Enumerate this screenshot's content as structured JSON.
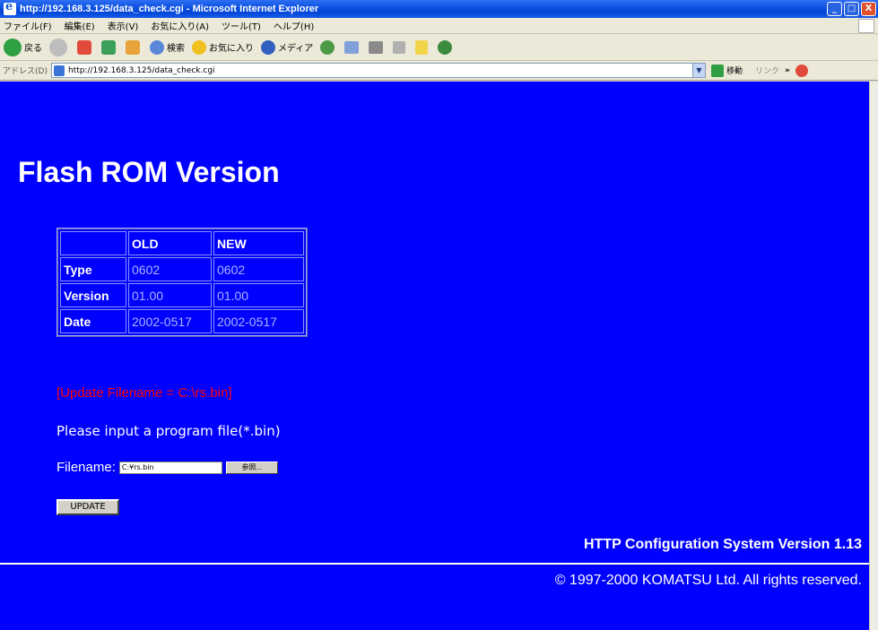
{
  "window": {
    "title": "http://192.168.3.125/data_check.cgi - Microsoft Internet Explorer",
    "buttons": {
      "minimize": "_",
      "maximize": "□",
      "close": "X"
    }
  },
  "menu": {
    "items": [
      "ファイル(F)",
      "編集(E)",
      "表示(V)",
      "お気に入り(A)",
      "ツール(T)",
      "ヘルプ(H)"
    ]
  },
  "toolbar": {
    "back_label": "戻る",
    "search_label": "検索",
    "favorites_label": "お気に入り",
    "media_label": "メディア",
    "icons": [
      "back-icon",
      "forward-icon",
      "stop-icon",
      "refresh-icon",
      "home-icon",
      "search-icon",
      "favorites-icon",
      "media-icon",
      "history-icon",
      "mail-icon",
      "print-icon",
      "edit-icon",
      "note-icon",
      "messenger-icon"
    ]
  },
  "address": {
    "label": "アドレス(D)",
    "url": "http://192.168.3.125/data_check.cgi",
    "go_label": "移動",
    "links_label": "リンク",
    "chevron": "»"
  },
  "page": {
    "title": "Flash ROM Version",
    "table": {
      "headers": [
        "",
        "OLD",
        "NEW"
      ],
      "rows": [
        {
          "label": "Type",
          "old": "0602",
          "new": "0602"
        },
        {
          "label": "Version",
          "old": "01.00",
          "new": "01.00"
        },
        {
          "label": "Date",
          "old": "2002-0517",
          "new": "2002-0517"
        }
      ]
    },
    "update_filename": "[Update Filename = C:\\rs.bin]",
    "prompt": "Please input a program file(*.bin)",
    "filename_label": "Filename:",
    "filename_value": "C:¥rs.bin",
    "browse_label": "参照...",
    "update_button": "UPDATE",
    "system_version": "HTTP Configuration System Version 1.13",
    "copyright": "© 1997-2000 KOMATSU Ltd. All rights reserved."
  },
  "colors": {
    "page_background": "#0000ff",
    "error_text": "#ff0000",
    "table_value_text": "#a9b4ff"
  }
}
